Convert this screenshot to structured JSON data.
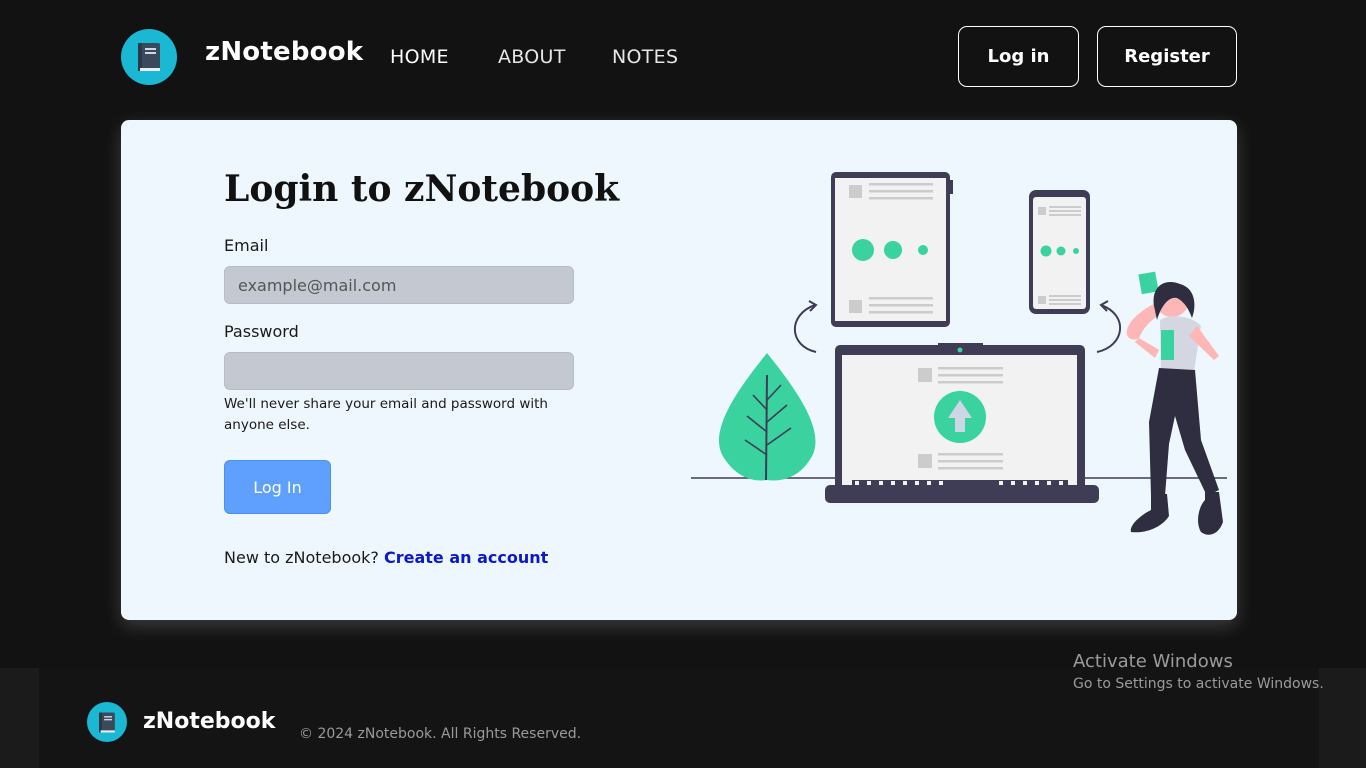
{
  "navbar": {
    "brand": "zNotebook",
    "links": [
      "HOME",
      "ABOUT",
      "NOTES"
    ],
    "login_label": "Log in",
    "register_label": "Register",
    "logo_icon": "notebook-icon"
  },
  "login": {
    "title": "Login to zNotebook",
    "email_label": "Email",
    "email_placeholder": "example@mail.com",
    "password_label": "Password",
    "help_text": "We'll never share your email and password with anyone else.",
    "submit_label": "Log In",
    "signup_prompt": "New to zNotebook?",
    "signup_link": "Create an account"
  },
  "footer": {
    "brand": "zNotebook",
    "copyright": "© 2024 zNotebook. All Rights Reserved."
  },
  "watermark": {
    "title": "Activate Windows",
    "subtitle": "Go to Settings to activate Windows."
  },
  "colors": {
    "background": "#121212",
    "logo_circle": "#1bb8d3",
    "card": "#eef7fe",
    "input": "#c3c8d1",
    "primary_button": "#5fa0ff",
    "link": "#0a19c9",
    "illustration_accent": "#3ad29f"
  }
}
